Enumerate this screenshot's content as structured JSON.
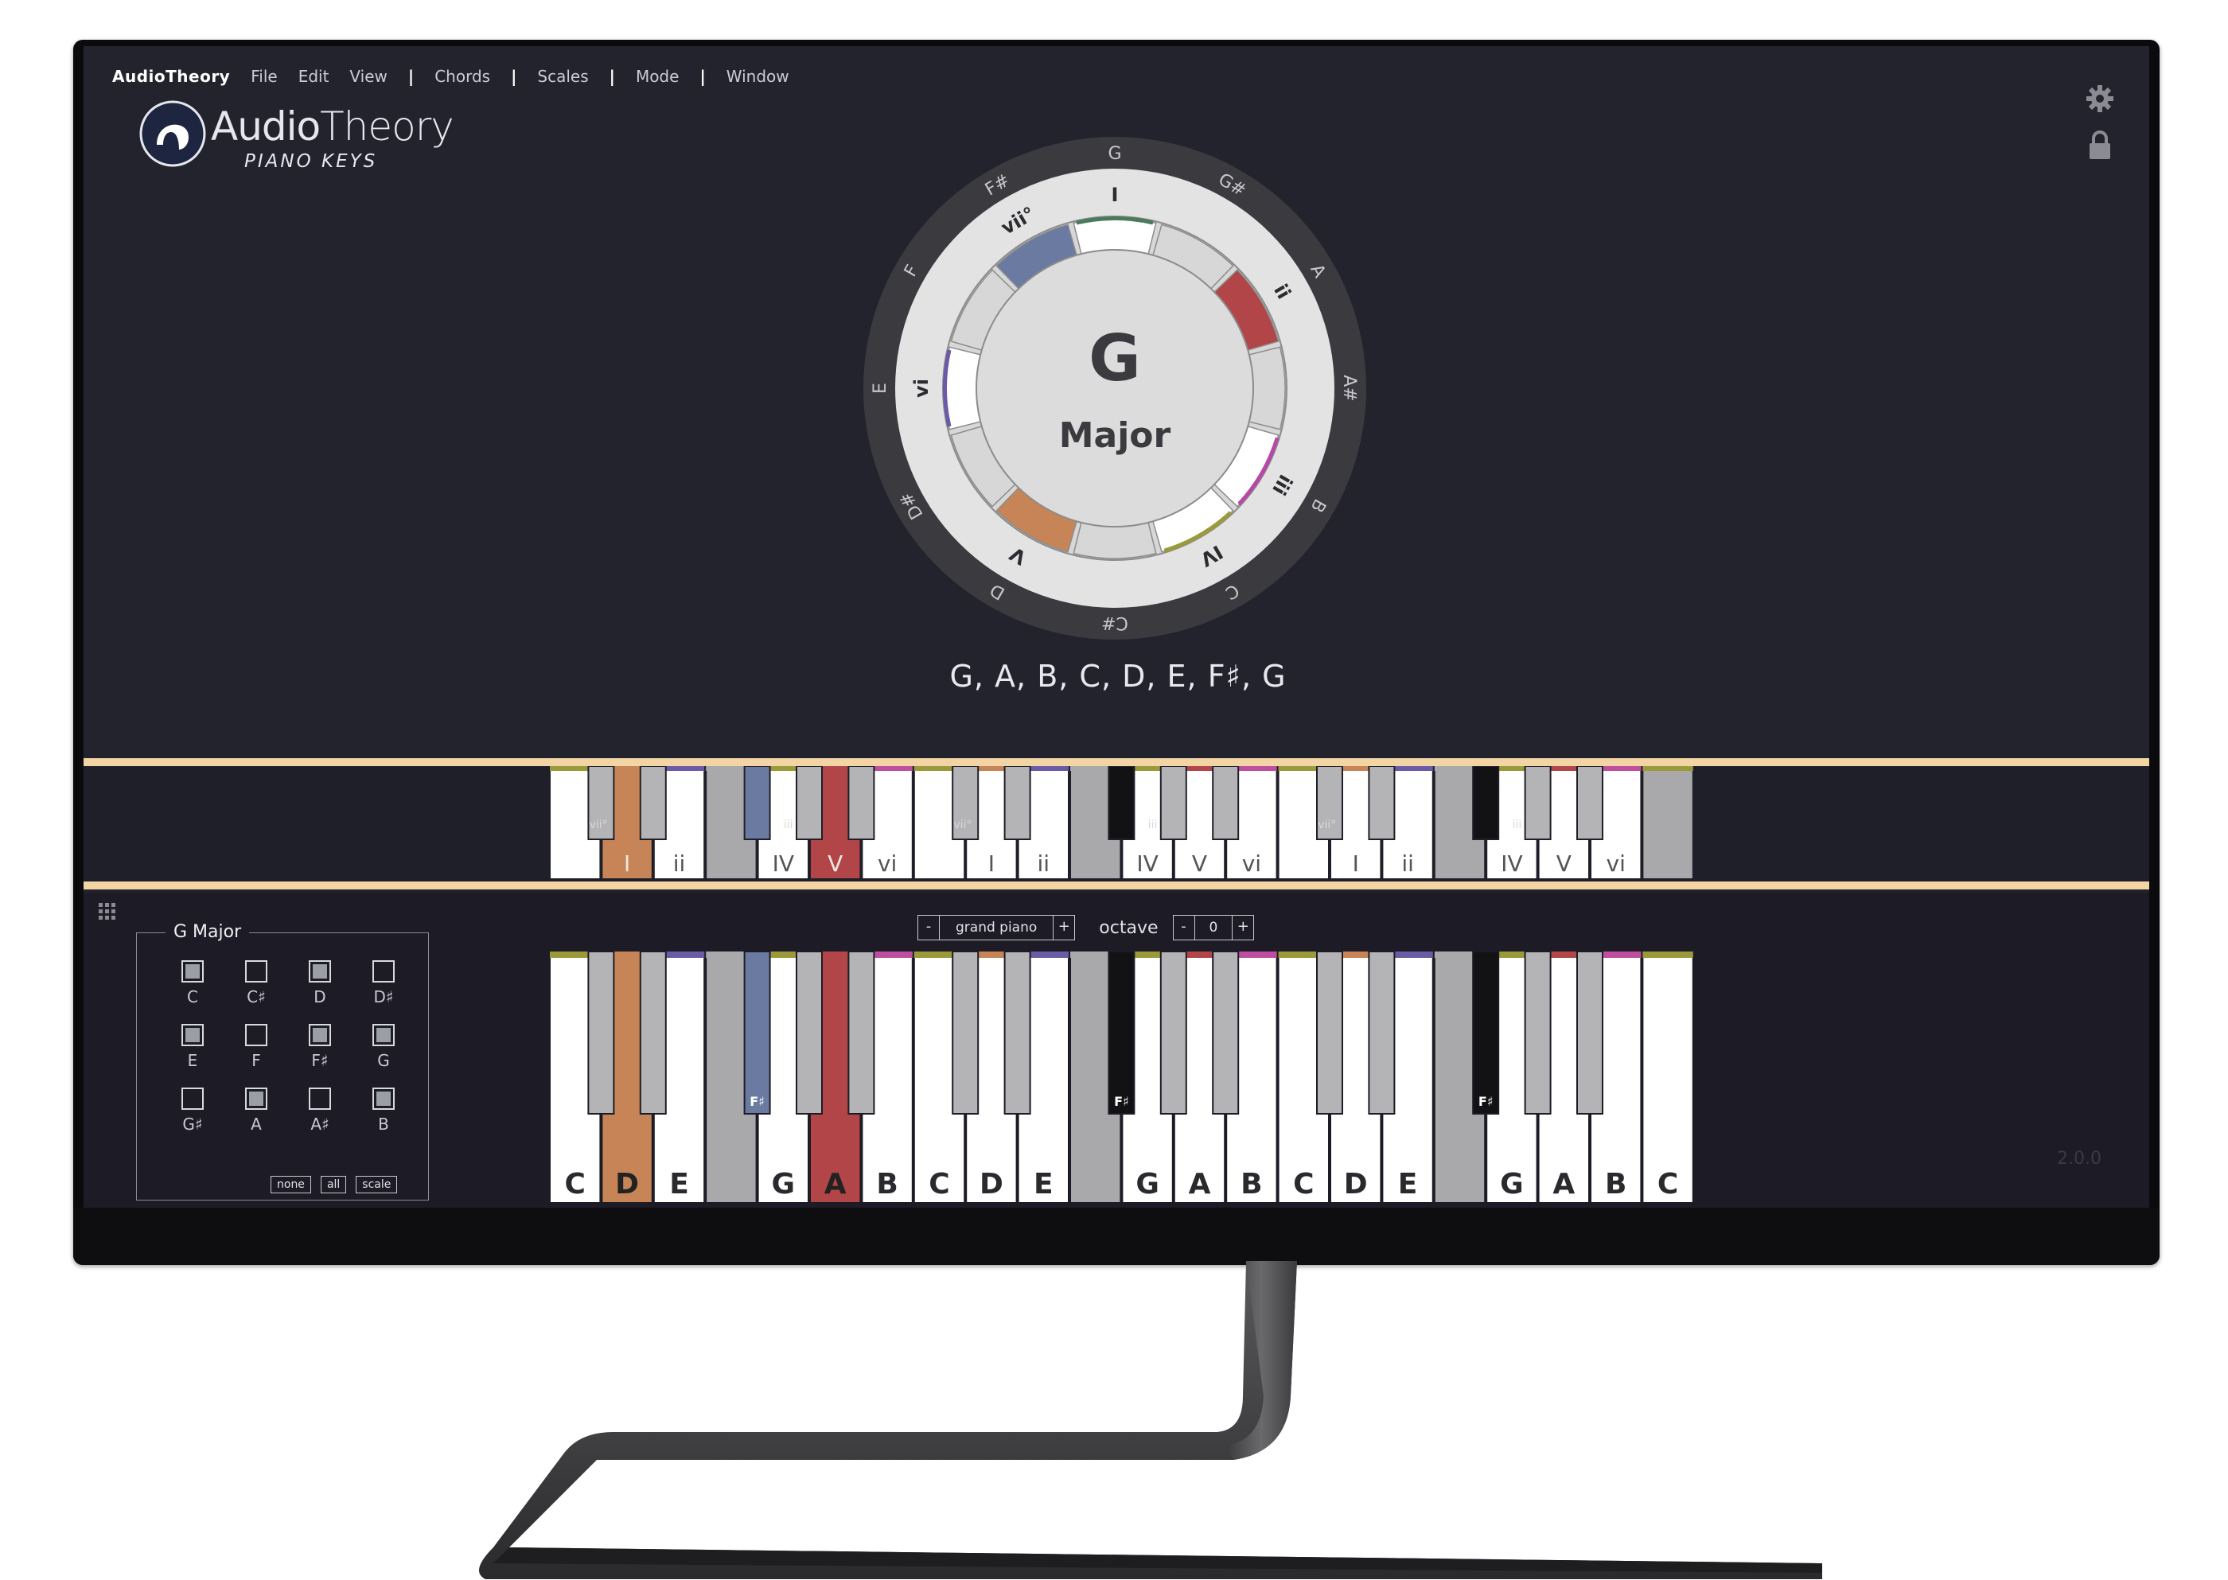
{
  "menu": {
    "app_name": "AudioTheory",
    "items": [
      "File",
      "Edit",
      "View"
    ],
    "items_after_sep": [
      "Chords",
      "Scales",
      "Mode",
      "Window"
    ]
  },
  "logo": {
    "name_part1": "Audio",
    "name_part2": "Theory",
    "subtitle": "PIANO KEYS"
  },
  "top_icons": [
    "gear-icon",
    "lock-icon"
  ],
  "circle": {
    "root": "G",
    "mode": "Major",
    "outer_notes": [
      "G",
      "G#",
      "A",
      "A#",
      "B",
      "C",
      "C#",
      "D",
      "D#",
      "E",
      "F",
      "F#"
    ],
    "degree_labels": [
      {
        "label": "I",
        "note_index": 0
      },
      {
        "label": "ii",
        "note_index": 2
      },
      {
        "label": "iii",
        "note_index": 4
      },
      {
        "label": "IV",
        "note_index": 5
      },
      {
        "label": "V",
        "note_index": 7
      },
      {
        "label": "vi",
        "note_index": 9
      },
      {
        "label": "vii°",
        "note_index": 11
      }
    ],
    "colors": {
      "I": "#ffffff",
      "ii": "#b14548",
      "iii": "#ffffff",
      "IV": "#ffffff",
      "V": "#c78456",
      "vi": "#ffffff",
      "vii": "#6a7aa0",
      "I_accent": "#4a7a5e",
      "iii_accent": "#b44aa6",
      "IV_accent": "#9a9a3a",
      "vi_accent": "#6b5aa6"
    }
  },
  "scale_notes": "G, A, B, C, D, E, F♯, G",
  "preview": {
    "labels": [
      "vii°",
      "I",
      "ii",
      "iii",
      "IV",
      "V",
      "vi",
      "vii°",
      "I",
      "ii",
      "iii",
      "IV",
      "V",
      "vi",
      "vii°",
      "I",
      "ii",
      "iii",
      "IV",
      "V",
      "vi"
    ]
  },
  "scale_selector": {
    "title": "G Major",
    "notes": [
      {
        "name": "C",
        "on": true
      },
      {
        "name": "C♯",
        "on": false
      },
      {
        "name": "D",
        "on": true
      },
      {
        "name": "D♯",
        "on": false
      },
      {
        "name": "E",
        "on": true
      },
      {
        "name": "F",
        "on": false
      },
      {
        "name": "F♯",
        "on": true
      },
      {
        "name": "G",
        "on": true
      },
      {
        "name": "G♯",
        "on": false
      },
      {
        "name": "A",
        "on": true
      },
      {
        "name": "A♯",
        "on": false
      },
      {
        "name": "B",
        "on": true
      }
    ],
    "buttons": {
      "none": "none",
      "all": "all",
      "scale": "scale"
    }
  },
  "instrument": {
    "minus": "-",
    "name": "grand piano",
    "plus": "+"
  },
  "octave": {
    "label": "octave",
    "minus": "-",
    "value": "0",
    "plus": "+"
  },
  "keyboard": {
    "white_keys": [
      {
        "n": "C",
        "state": "normal"
      },
      {
        "n": "D",
        "state": "orange"
      },
      {
        "n": "E",
        "state": "normal"
      },
      {
        "n": "",
        "state": "grey"
      },
      {
        "n": "G",
        "state": "normal"
      },
      {
        "n": "A",
        "state": "red"
      },
      {
        "n": "B",
        "state": "normal"
      },
      {
        "n": "C",
        "state": "normal"
      },
      {
        "n": "D",
        "state": "normal"
      },
      {
        "n": "E",
        "state": "normal"
      },
      {
        "n": "",
        "state": "grey"
      },
      {
        "n": "G",
        "state": "normal"
      },
      {
        "n": "A",
        "state": "normal"
      },
      {
        "n": "B",
        "state": "normal"
      },
      {
        "n": "C",
        "state": "normal"
      },
      {
        "n": "D",
        "state": "normal"
      },
      {
        "n": "E",
        "state": "normal"
      },
      {
        "n": "",
        "state": "grey"
      },
      {
        "n": "G",
        "state": "normal"
      },
      {
        "n": "A",
        "state": "normal"
      },
      {
        "n": "B",
        "state": "normal"
      },
      {
        "n": "C",
        "state": "normal"
      }
    ],
    "black_label": "F♯"
  },
  "version": "2.0.0"
}
